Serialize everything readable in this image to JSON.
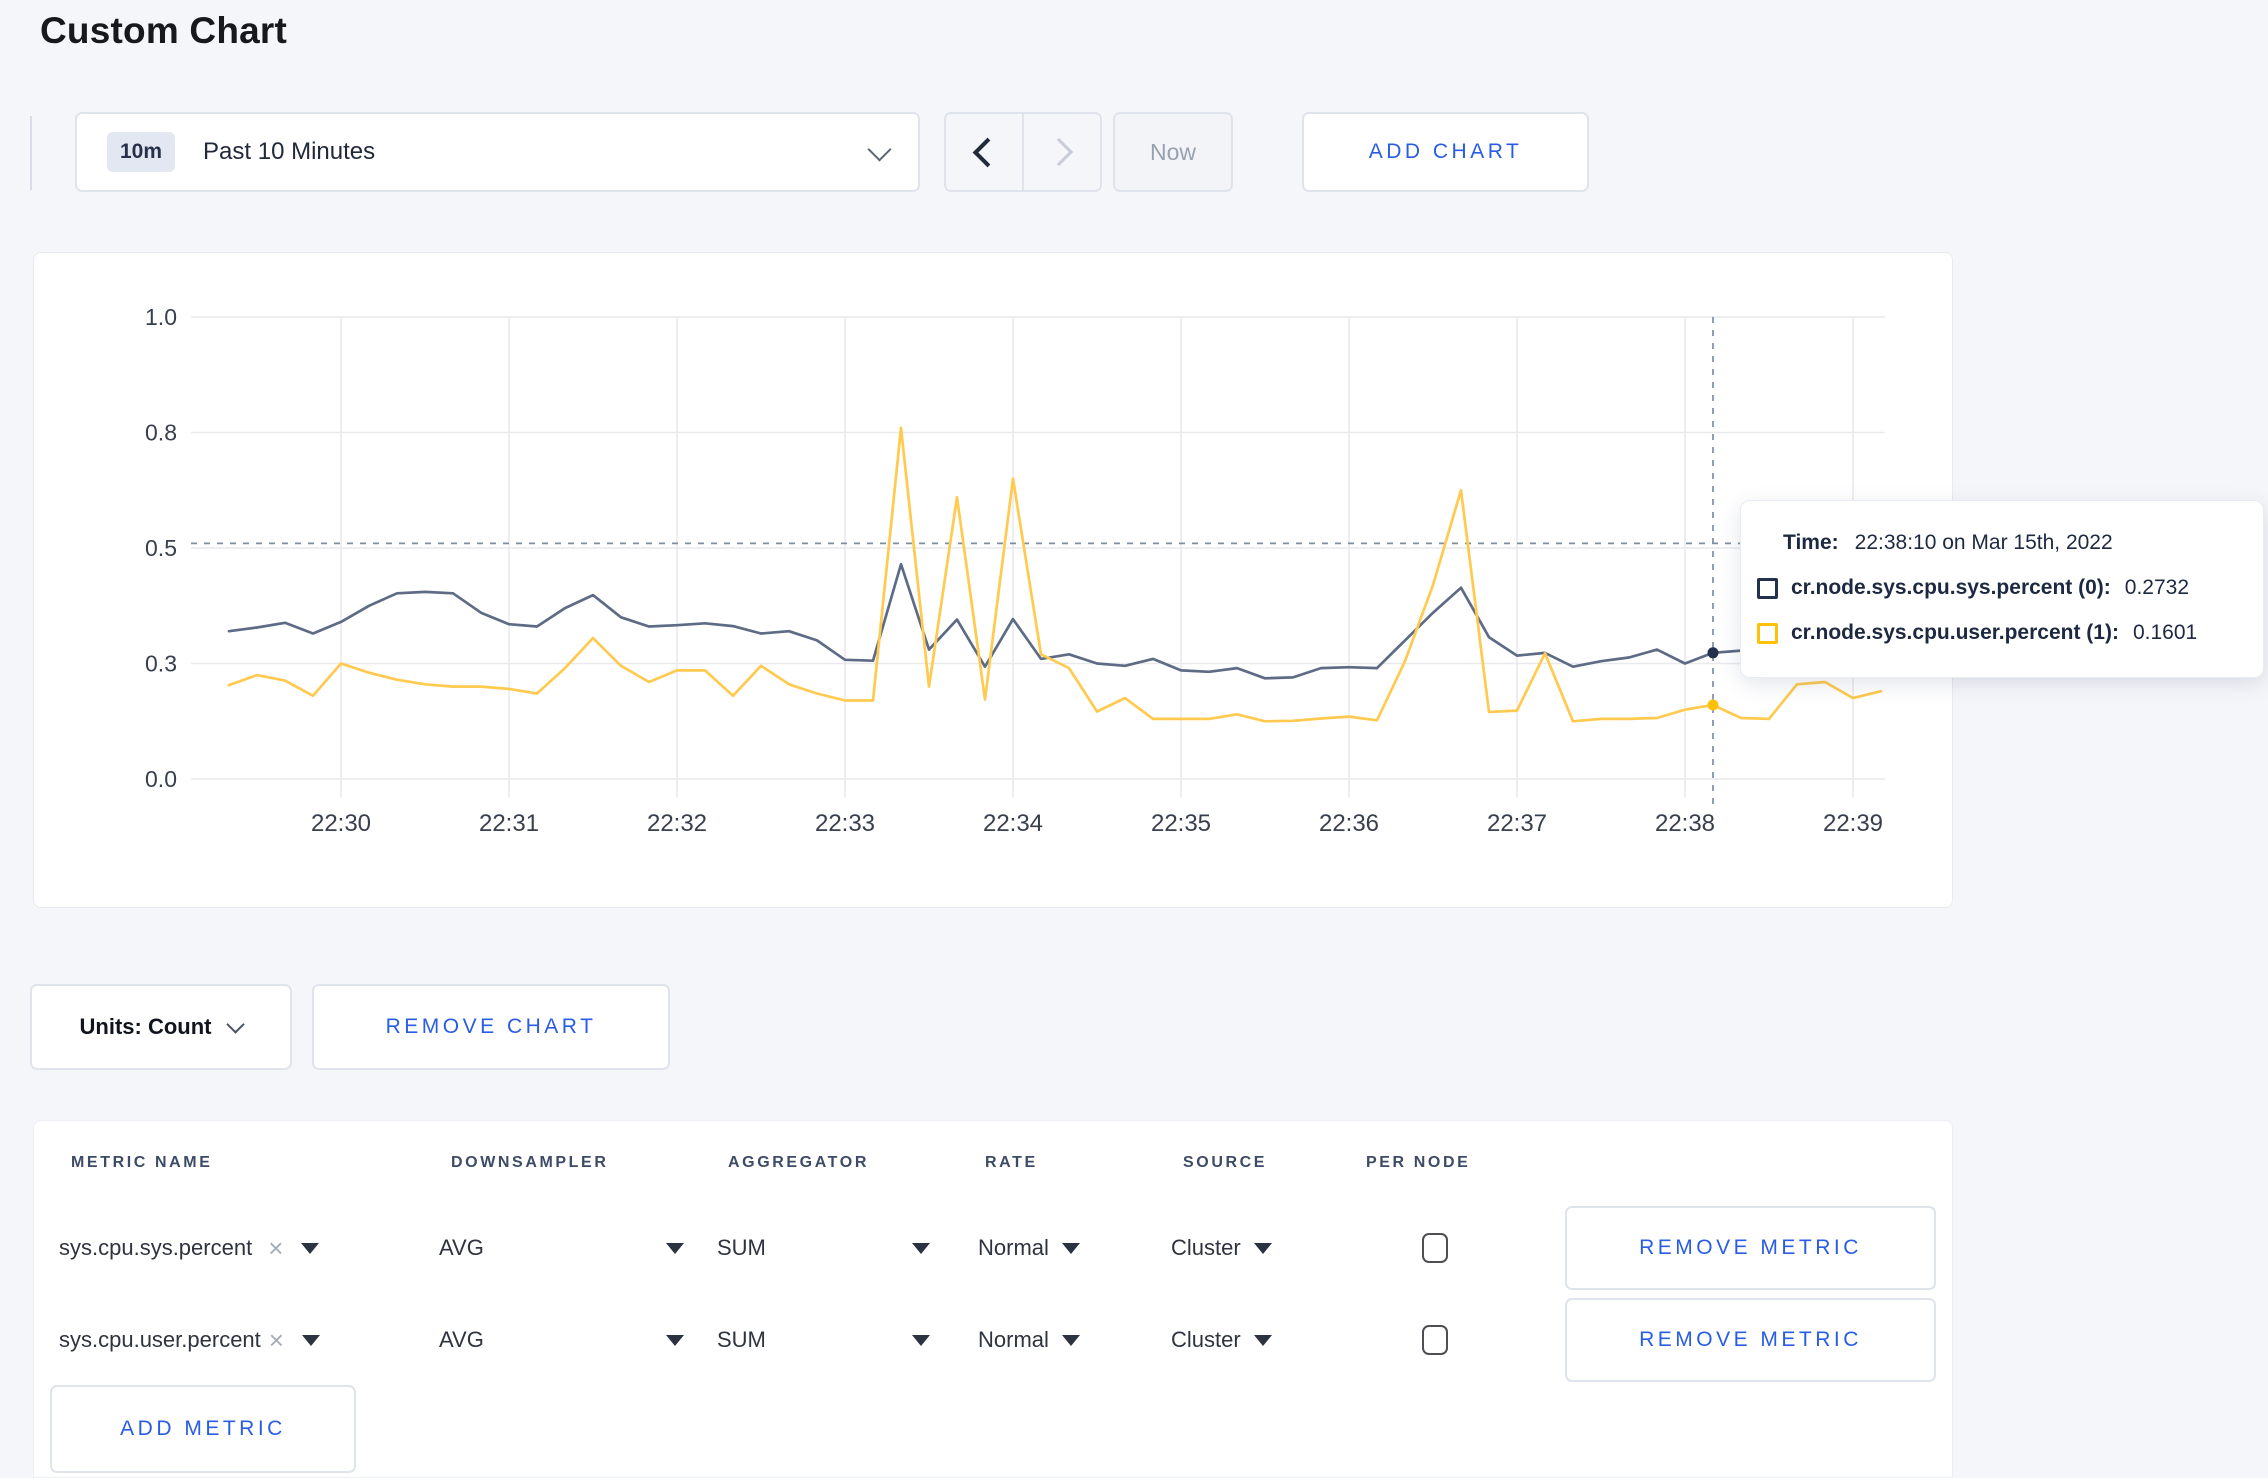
{
  "page": {
    "title": "Custom Chart"
  },
  "colors": {
    "background": "#f5f6fa",
    "accent_blue": "#2a5ce4",
    "sys_line": "#5d6b85",
    "sys_swatch": "#23324c",
    "user_line": "#ffca4f",
    "user_swatch": "#ffc107",
    "gridline": "#e9e9ee",
    "crosshair": "#7d8da6"
  },
  "controls": {
    "range_badge": "10m",
    "range_label": "Past 10 Minutes",
    "now_label": "Now",
    "add_chart_label": "ADD CHART"
  },
  "chart_data": {
    "type": "line",
    "title": "",
    "xlabel": "",
    "ylabel": "",
    "ylim": [
      0,
      1
    ],
    "grid": true,
    "legend_position": "tooltip-only",
    "y_ticks": [
      {
        "value": 0,
        "label": "0.0"
      },
      {
        "value": 0.25,
        "label": "0.3"
      },
      {
        "value": 0.5,
        "label": "0.5"
      },
      {
        "value": 0.75,
        "label": "0.8"
      },
      {
        "value": 1,
        "label": "1.0"
      }
    ],
    "x_ticks": [
      "22:30",
      "22:31",
      "22:32",
      "22:33",
      "22:34",
      "22:35",
      "22:36",
      "22:37",
      "22:38",
      "22:39"
    ],
    "first_sample_time": "22:29:20",
    "first_sample_offset_seconds": -40,
    "sample_step_seconds": 10,
    "hover_index": 53,
    "hover_time": "22:38:10",
    "crosshair_value": 0.51,
    "series": [
      {
        "name": "cr.node.sys.cpu.sys.percent",
        "node": "(0)",
        "color": "#5d6b85",
        "swatch_color": "#23324c",
        "hover_value": 0.2732,
        "values": [
          0.32,
          0.328,
          0.338,
          0.315,
          0.34,
          0.375,
          0.402,
          0.405,
          0.402,
          0.36,
          0.335,
          0.33,
          0.37,
          0.398,
          0.35,
          0.33,
          0.333,
          0.337,
          0.331,
          0.315,
          0.32,
          0.3,
          0.258,
          0.256,
          0.465,
          0.28,
          0.345,
          0.243,
          0.346,
          0.26,
          0.27,
          0.25,
          0.245,
          0.26,
          0.235,
          0.232,
          0.24,
          0.218,
          0.22,
          0.24,
          0.242,
          0.24,
          0.3,
          0.36,
          0.414,
          0.307,
          0.267,
          0.273,
          0.243,
          0.255,
          0.263,
          0.28,
          0.25,
          0.2732,
          0.278,
          0.292,
          0.3,
          0.296,
          0.302,
          0.3
        ]
      },
      {
        "name": "cr.node.sys.cpu.user.percent",
        "node": "(1)",
        "color": "#ffca4f",
        "swatch_color": "#ffc107",
        "hover_value": 0.1601,
        "values": [
          0.203,
          0.225,
          0.213,
          0.18,
          0.25,
          0.23,
          0.215,
          0.205,
          0.2,
          0.2,
          0.195,
          0.185,
          0.24,
          0.305,
          0.245,
          0.21,
          0.235,
          0.235,
          0.18,
          0.245,
          0.205,
          0.185,
          0.17,
          0.17,
          0.76,
          0.2,
          0.61,
          0.172,
          0.65,
          0.27,
          0.24,
          0.146,
          0.175,
          0.13,
          0.13,
          0.13,
          0.14,
          0.125,
          0.126,
          0.131,
          0.135,
          0.127,
          0.255,
          0.42,
          0.625,
          0.145,
          0.148,
          0.272,
          0.125,
          0.13,
          0.13,
          0.132,
          0.15,
          0.1601,
          0.132,
          0.13,
          0.205,
          0.21,
          0.175,
          0.19
        ]
      }
    ]
  },
  "tooltip": {
    "time_label": "Time:",
    "time_value": "22:38:10 on Mar 15th, 2022",
    "rows": [
      {
        "label": "cr.node.sys.cpu.sys.percent (0):",
        "value": "0.2732",
        "color": "#23324c"
      },
      {
        "label": "cr.node.sys.cpu.user.percent (1):",
        "value": "0.1601",
        "color": "#ffc107"
      }
    ]
  },
  "units": {
    "label": "Units: Count",
    "remove_chart_label": "REMOVE CHART"
  },
  "table": {
    "headers": [
      "METRIC NAME",
      "DOWNSAMPLER",
      "AGGREGATOR",
      "RATE",
      "SOURCE",
      "PER NODE"
    ],
    "metrics": [
      {
        "name": "sys.cpu.sys.percent",
        "downsampler": "AVG",
        "aggregator": "SUM",
        "rate": "Normal",
        "source": "Cluster",
        "per_node": false,
        "remove_label": "REMOVE METRIC"
      },
      {
        "name": "sys.cpu.user.percent",
        "downsampler": "AVG",
        "aggregator": "SUM",
        "rate": "Normal",
        "source": "Cluster",
        "per_node": false,
        "remove_label": "REMOVE METRIC"
      }
    ],
    "add_metric_label": "ADD METRIC"
  },
  "icons": {
    "clear": "×"
  }
}
